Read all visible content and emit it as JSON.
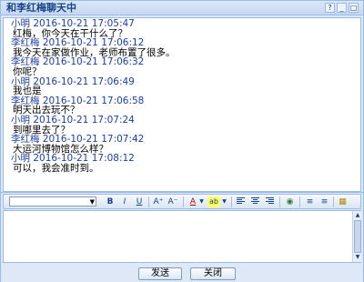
{
  "window": {
    "title": "和李红梅聊天中",
    "controls": [
      "?",
      "_",
      "□"
    ]
  },
  "messages": [
    {
      "sender": "小明",
      "timestamp": "2016-10-21 17:05:47",
      "text": "红梅，你今天在干什么了？"
    },
    {
      "sender": "李红梅",
      "timestamp": "2016-10-21 17:06:12",
      "text": "我今天在家做作业，老师布置了很多。"
    },
    {
      "sender": "李红梅",
      "timestamp": "2016-10-21 17:06:32",
      "text": "你呢？"
    },
    {
      "sender": "小明",
      "timestamp": "2016-10-21 17:06:49",
      "text": "我也是"
    },
    {
      "sender": "李红梅",
      "timestamp": "2016-10-21 17:06:58",
      "text": "明天出去玩不？"
    },
    {
      "sender": "小明",
      "timestamp": "2016-10-21 17:07:24",
      "text": "到哪里去了？"
    },
    {
      "sender": "李红梅",
      "timestamp": "2016-10-21 17:07:42",
      "text": "大运河博物馆怎么样？"
    },
    {
      "sender": "小明",
      "timestamp": "2016-10-21 17:08:12",
      "text": "可以，我会准时到。"
    }
  ],
  "toolbar": {
    "bold": "B",
    "italic": "I",
    "underline": "U",
    "grow": "A⁺",
    "shrink": "A⁻",
    "fontcolor": "A",
    "highlight": "ab",
    "link": "◉",
    "ordered": "≡",
    "unordered": "≡",
    "source": "▦"
  },
  "editor": {
    "value": ""
  },
  "buttons": {
    "send": "发送",
    "close": "关闭"
  },
  "colors": {
    "sender": "#1a3ea8",
    "border": "#99bbe8",
    "panel": "#dfe8f6"
  }
}
